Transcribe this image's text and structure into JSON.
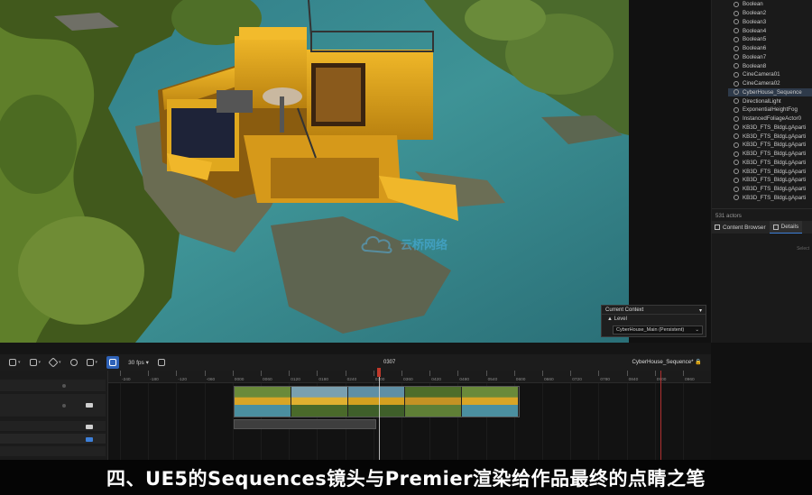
{
  "outliner": {
    "items": [
      "Boolean",
      "Boolean2",
      "Boolean3",
      "Boolean4",
      "Boolean5",
      "Boolean6",
      "Boolean7",
      "Boolean8",
      "CineCamera01",
      "CineCamera02",
      "CyberHouse_Sequence",
      "DirectionalLight",
      "ExponentialHeightFog",
      "InstancedFoliageActor0",
      "KB3D_FTS_BldgLgAparti",
      "KB3D_FTS_BldgLgAparti",
      "KB3D_FTS_BldgLgAparti",
      "KB3D_FTS_BldgLgAparti",
      "KB3D_FTS_BldgLgAparti",
      "KB3D_FTS_BldgLgAparti",
      "KB3D_FTS_BldgLgAparti",
      "KB3D_FTS_BldgLgAparti",
      "KB3D_FTS_BldgLgAparti"
    ],
    "actor_count": "531 actors",
    "tabs": [
      "Content Browser",
      "Details"
    ],
    "select_hint": "Select"
  },
  "context": {
    "title": "Current Context",
    "level_label": "Level",
    "level_value": "CyberHouse_Main (Persistent)"
  },
  "sequencer": {
    "fps": "30 fps",
    "sequence_name": "CyberHouse_Sequence*",
    "current_frame": "0307",
    "ruler_ticks": [
      "-240",
      "-180",
      "-120",
      "-060",
      "0000",
      "0060",
      "0120",
      "0180",
      "0240",
      "0300",
      "0360",
      "0420",
      "0480",
      "0540",
      "0600",
      "0660",
      "0720",
      "0780",
      "0840",
      "0900",
      "0960"
    ]
  },
  "watermark": "云桥网络",
  "subtitle": "四、UE5的Sequences镜头与Premier渲染给作品最终的点睛之笔",
  "colors": {
    "house_yellow": "#e3a91c",
    "water": "#3f8f92",
    "foliage": "#5c7a2a",
    "accent_blue": "#2e62b8",
    "playhead_red": "#c0392b"
  }
}
